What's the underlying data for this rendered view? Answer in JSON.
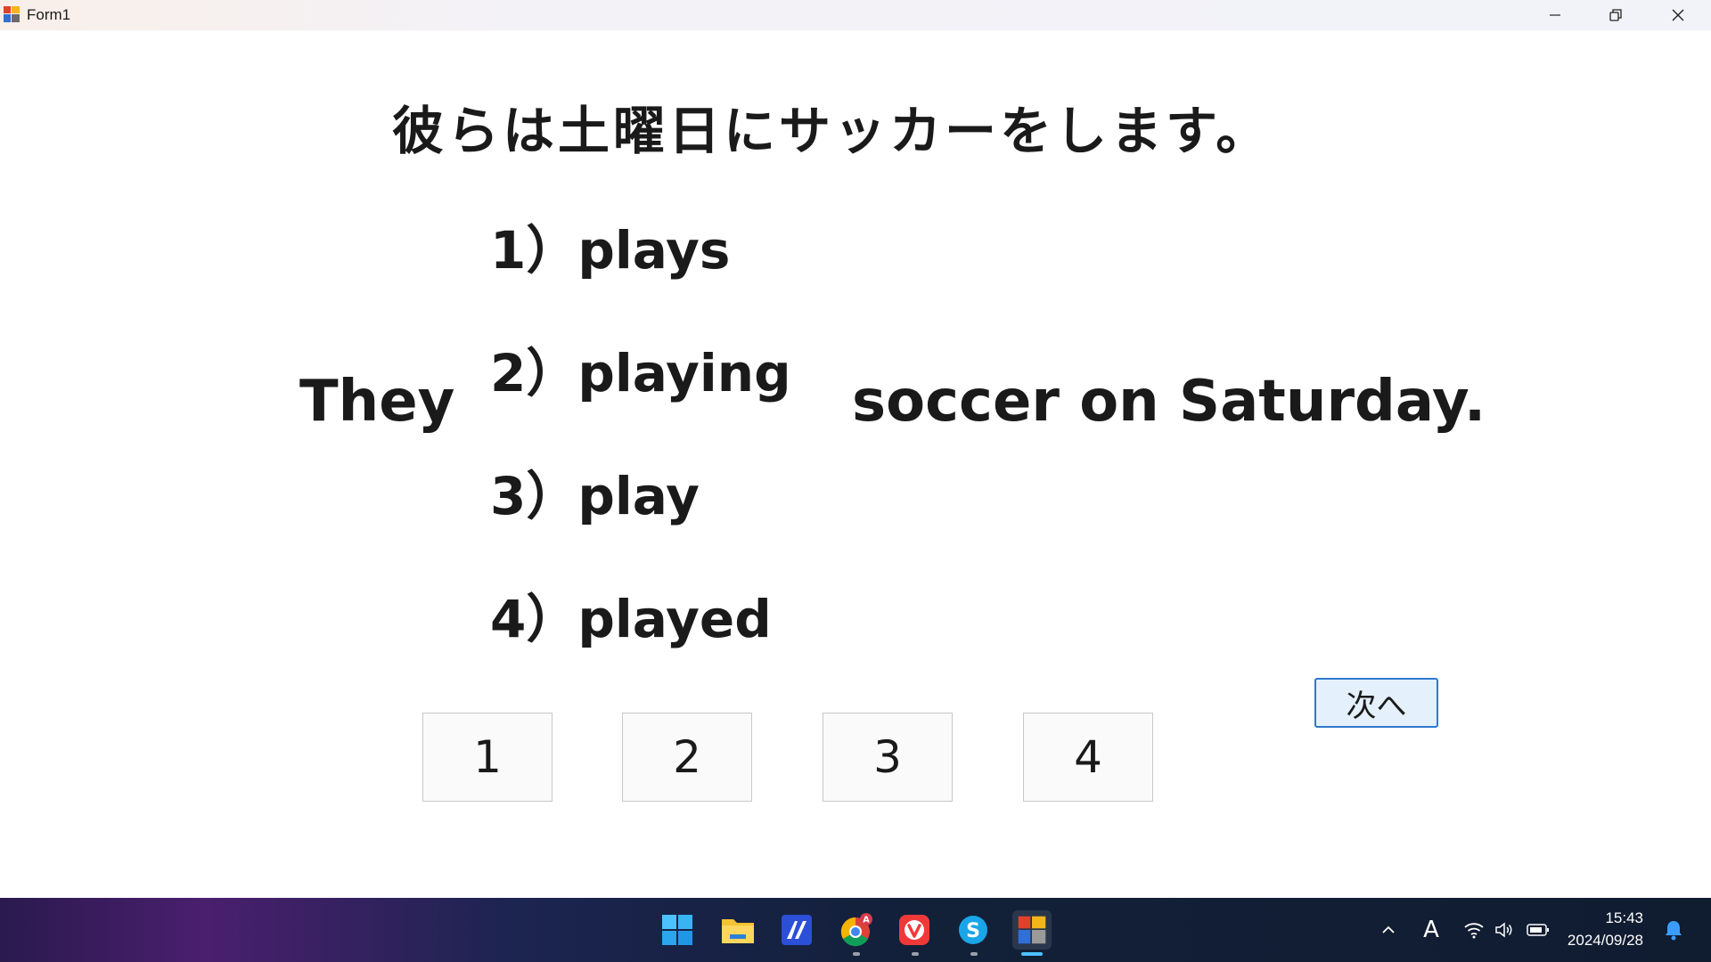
{
  "window": {
    "title": "Form1"
  },
  "question": {
    "japanese_sentence": "彼らは土曜日にサッカーをします。",
    "before_blank": "They",
    "after_blank": "soccer on Saturday.",
    "options": [
      {
        "label": "1）plays"
      },
      {
        "label": "2）playing"
      },
      {
        "label": "3）play"
      },
      {
        "label": "4）played"
      }
    ]
  },
  "answer_buttons": [
    {
      "label": "1"
    },
    {
      "label": "2"
    },
    {
      "label": "3"
    },
    {
      "label": "4"
    }
  ],
  "next_button": {
    "label": "次へ"
  },
  "taskbar": {
    "pinned": [
      {
        "icon": "windows-start-icon"
      },
      {
        "icon": "file-explorer-icon"
      },
      {
        "icon": "editor-app-icon"
      },
      {
        "icon": "chrome-icon",
        "badge": "A"
      },
      {
        "icon": "vivaldi-icon"
      },
      {
        "icon": "skype-icon"
      },
      {
        "icon": "form-app-icon"
      }
    ],
    "ime_indicator": "A",
    "time": "15:43",
    "date": "2024/09/28"
  },
  "colors": {
    "next_button_border": "#2e79cf",
    "next_button_fill": "#e4f0fb",
    "notification_bell": "#3b9cff"
  }
}
